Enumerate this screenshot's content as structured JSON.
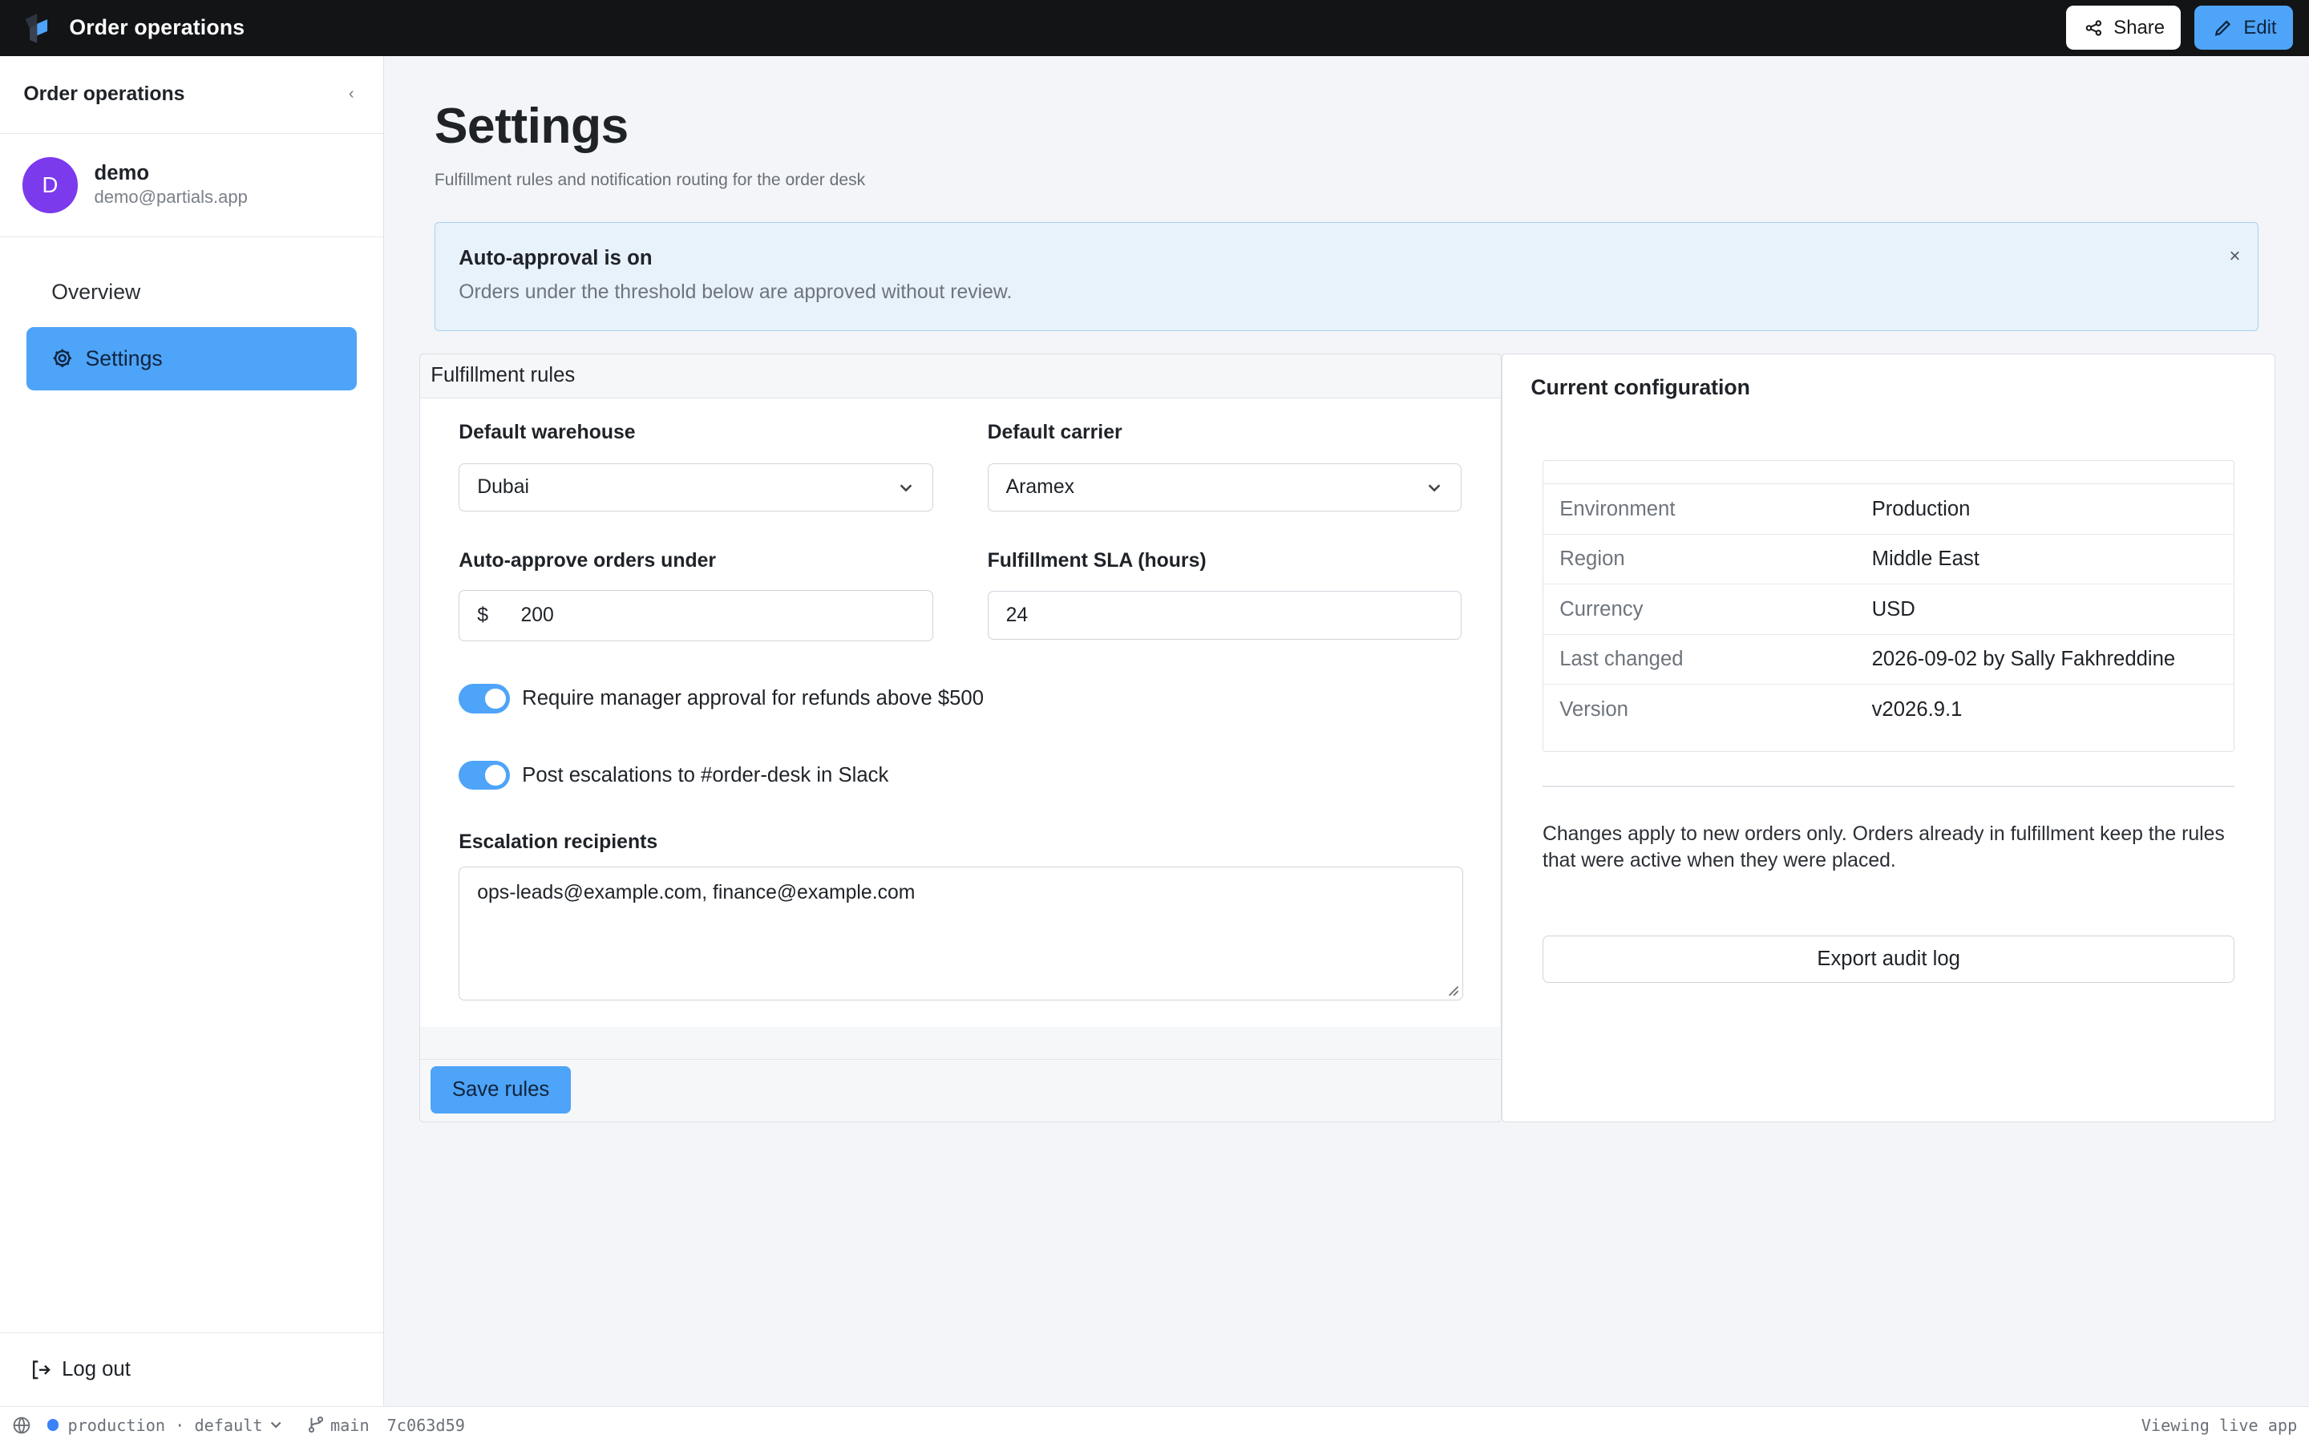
{
  "app": {
    "title": "Order operations",
    "share_label": "Share",
    "edit_label": "Edit"
  },
  "sidebar": {
    "title": "Order operations",
    "collapse_glyph": "‹",
    "user": {
      "initial": "D",
      "name": "demo",
      "email": "demo@partials.app"
    },
    "nav": [
      {
        "label": "Overview",
        "active": false
      },
      {
        "label": "Settings",
        "active": true,
        "icon": "gear-icon"
      }
    ],
    "logout_label": "Log out"
  },
  "page": {
    "title": "Settings",
    "subtitle": "Fulfillment rules and notification routing for the order desk"
  },
  "alert": {
    "title": "Auto-approval is on",
    "body": "Orders under the threshold below are approved without review.",
    "close_glyph": "×"
  },
  "rules": {
    "title": "Fulfillment rules",
    "warehouse": {
      "label": "Default warehouse",
      "value": "Dubai"
    },
    "carrier": {
      "label": "Default carrier",
      "value": "Aramex"
    },
    "auto_approve": {
      "label": "Auto-approve orders under",
      "prefix": "$",
      "value": "200"
    },
    "sla": {
      "label": "Fulfillment SLA (hours)",
      "value": "24"
    },
    "toggles": [
      {
        "label": "Require manager approval for refunds above $500",
        "on": true
      },
      {
        "label": "Post escalations to #order-desk in Slack",
        "on": true
      }
    ],
    "recipients": {
      "label": "Escalation recipients",
      "value": "ops-leads@example.com, finance@example.com"
    },
    "save_label": "Save rules"
  },
  "config": {
    "title": "Current configuration",
    "rows": [
      {
        "key": "Environment",
        "value": "Production"
      },
      {
        "key": "Region",
        "value": "Middle East"
      },
      {
        "key": "Currency",
        "value": "USD"
      },
      {
        "key": "Last changed",
        "value": "2026-09-02 by Sally Fakhreddine"
      },
      {
        "key": "Version",
        "value": "v2026.9.1"
      }
    ],
    "note": "Changes apply to new orders only. Orders already in fulfillment keep the rules that were active when they were placed.",
    "export_label": "Export audit log"
  },
  "statusbar": {
    "environment": "production · default",
    "branch": "main",
    "commit": "7c063d59",
    "right_text": "Viewing live app"
  },
  "colors": {
    "accent": "#4ea4f8",
    "topbar": "#131416",
    "avatar": "#7c3aed",
    "status_dot": "#3b82f6",
    "alert_bg": "#e8f2fb"
  }
}
